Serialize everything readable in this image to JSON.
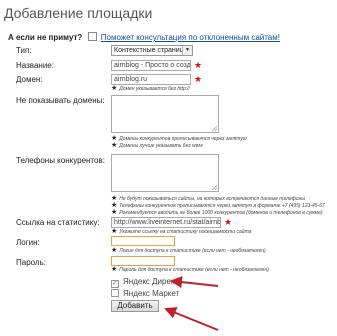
{
  "page": {
    "title": "Добавление площадки",
    "subhead_bold": "А если не примут?",
    "subhead_link": "Поможет консультация по отклоненным сайтам!"
  },
  "form": {
    "type": {
      "label": "Тип:",
      "value": "Контекстные страницы"
    },
    "name": {
      "label": "Название:",
      "value": "airnblog - Просто о создании"
    },
    "domain": {
      "label": "Домен:",
      "value": "airnblog.ru",
      "hint": "Домен указывается без http://"
    },
    "hide_domains": {
      "label": "Не показывать домены:",
      "hints": [
        "Домены конкурентов прописываются через запятую",
        "Домены лучше указывать без www"
      ]
    },
    "competitor_phones": {
      "label": "Телефоны конкурентов:",
      "hints": [
        "Не будут показываться сайты, на которых встречаются данные телефоны",
        "Телефоны конкурентов прописываются через запятую в формате +7 (495) 123-45-67",
        "Рекомендуется вводить не более 1000 конкурентов (доменов и телефонов в сумме)"
      ]
    },
    "stats_link": {
      "label": "Ссылка на статистику:",
      "value": "http://www.liveinternet.ru/stat/airnblog.ru/index.html",
      "hint": "Укажите ссылку на статистику посещаемости сайта"
    },
    "login": {
      "label": "Логин:",
      "value": "",
      "hint": "Логин для доступа к статистике (если нет - необязателен)"
    },
    "password": {
      "label": "Пароль:",
      "value": "",
      "hint": "Пароль для доступа к статистике (если нет - необязателен)"
    },
    "yandex_direct": {
      "label": "Яндекс Директ",
      "checked": true
    },
    "yandex_market": {
      "label": "Яндекс Маркет",
      "checked": false
    },
    "submit_label": "Добавить"
  },
  "icons": {
    "required": "red-star",
    "note": "black-star"
  },
  "colors": {
    "required": "#dd1111",
    "focus_border": "#e8a33c",
    "annotation_arrow": "#c0202a"
  }
}
